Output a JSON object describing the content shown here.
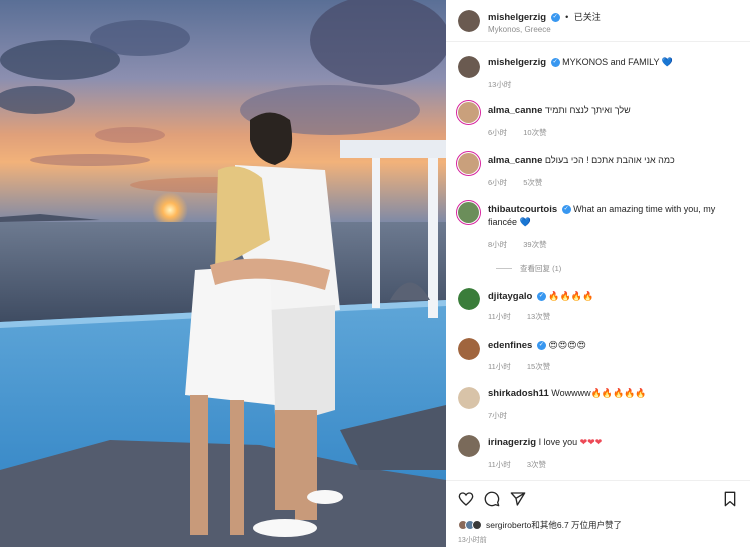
{
  "header": {
    "username": "mishelgerzig",
    "separator": "•",
    "follow_state": "已关注",
    "location": "Mykonos, Greece"
  },
  "caption": {
    "username": "mishelgerzig",
    "text": "MYKONOS and FAMILY",
    "emoji": "💙",
    "time": "13小时"
  },
  "comments": [
    {
      "username": "alma_canne",
      "text": "שלך ואיתך לנצח ותמיד",
      "emoji": "",
      "time": "6小时",
      "likes": "10次赞",
      "avatar_color": "#c9a07c"
    },
    {
      "username": "alma_canne",
      "text": "כמה אני אוהבת אתכם ! הכי בעולם",
      "emoji": "",
      "time": "6小时",
      "likes": "5次赞",
      "avatar_color": "#c9a07c"
    },
    {
      "username": "thibautcourtois",
      "text": "What an amazing time with you, my fiancée",
      "emoji": "💙",
      "time": "8小时",
      "likes": "39次赞",
      "avatar_color": "#6b8e5a"
    },
    {
      "username": "djitaygalo",
      "text": "",
      "emoji": "🔥🔥🔥🔥",
      "time": "11小时",
      "likes": "13次赞",
      "avatar_color": "#3a7d3a"
    },
    {
      "username": "edenfines",
      "text": "",
      "emoji": "😍😍😍😍",
      "time": "11小时",
      "likes": "15次赞",
      "avatar_color": "#a0653e"
    },
    {
      "username": "shirkadosh11",
      "text": "Wowwww",
      "emoji": "🔥🔥🔥🔥🔥",
      "time": "7小时",
      "likes": "",
      "avatar_color": "#d8c3a8"
    },
    {
      "username": "irinagerzig",
      "text": "I love you",
      "emoji": "❤❤❤",
      "time": "11小时",
      "likes": "3次赞",
      "avatar_color": "#7a6a5a"
    }
  ],
  "view_replies": "查看回复 (1)",
  "likes_line": "sergiroberto和其他6.7 万位用户赞了",
  "post_time": "13小时前",
  "colors": {
    "verified": "#3897f0",
    "link": "#3897f0",
    "muted": "#8e8e8e"
  },
  "icons": [
    "heart-icon",
    "comment-icon",
    "share-icon",
    "bookmark-icon",
    "verified-badge-icon"
  ]
}
